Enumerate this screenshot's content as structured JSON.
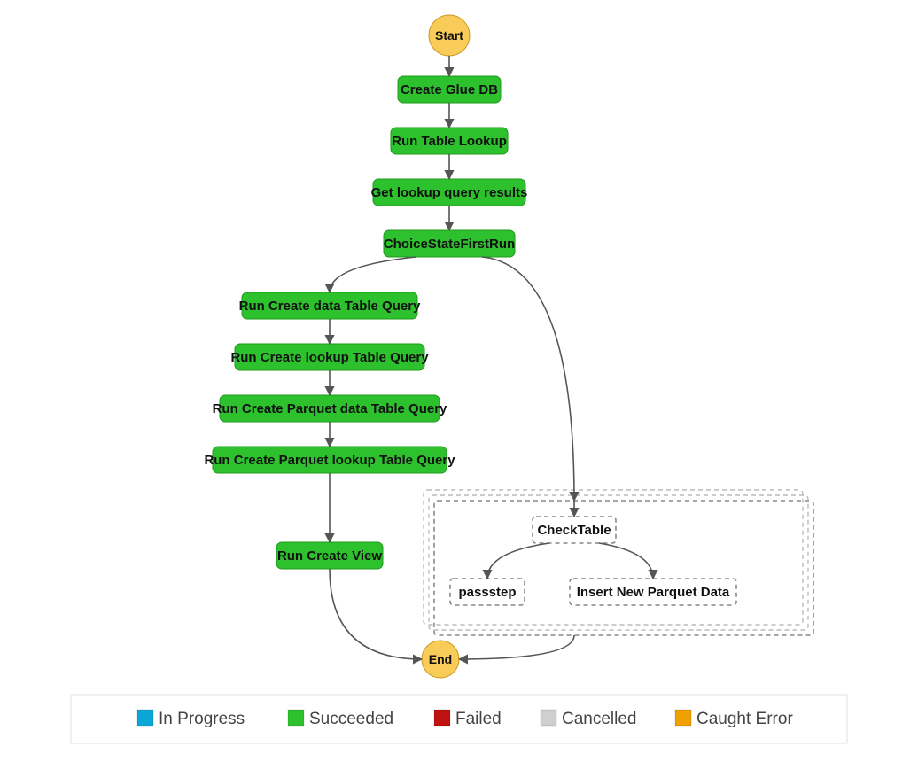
{
  "diagram": {
    "start": "Start",
    "end": "End",
    "steps": {
      "create_glue_db": "Create Glue DB",
      "run_table_lookup": "Run Table Lookup",
      "get_lookup_results": "Get lookup query results",
      "choice_first_run": "ChoiceStateFirstRun",
      "create_data_table": "Run Create data Table Query",
      "create_lookup_table": "Run Create lookup Table Query",
      "create_parquet_data": "Run Create Parquet data Table Query",
      "create_parquet_lookup": "Run Create Parquet lookup Table Query",
      "create_view": "Run Create View",
      "check_table": "CheckTable",
      "passstep": "passstep",
      "insert_parquet": "Insert New Parquet Data"
    }
  },
  "legend": {
    "in_progress": "In Progress",
    "succeeded": "Succeeded",
    "failed": "Failed",
    "cancelled": "Cancelled",
    "caught_error": "Caught Error"
  },
  "colors": {
    "in_progress": "#0aa6d6",
    "succeeded": "#2dc12d",
    "failed": "#c11212",
    "cancelled": "#cfcfcf",
    "caught_error": "#f0a000"
  }
}
